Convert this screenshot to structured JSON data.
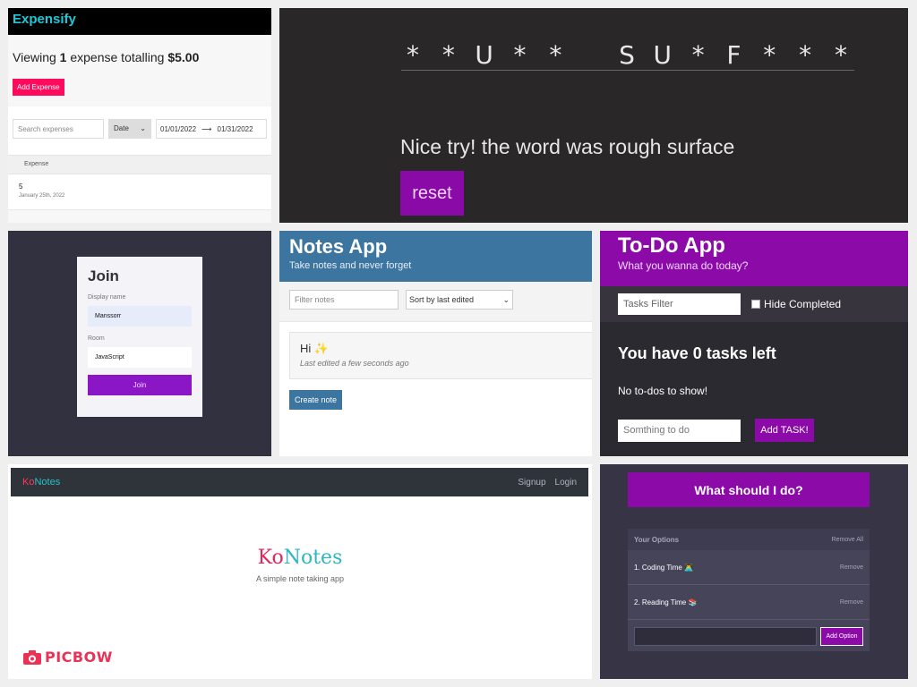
{
  "expensify": {
    "title": "Expensify",
    "summary_prefix": "Viewing",
    "summary_count": "1",
    "summary_mid": "expense totalling",
    "summary_total": "$5.00",
    "add_button": "Add Expense",
    "search_placeholder": "Search expenses",
    "sort_value": "Date",
    "start_date": "01/01/2022",
    "end_date": "01/31/2022",
    "table_header": "Expense",
    "rows": [
      {
        "amount": "5",
        "date": "January 25th, 2022"
      }
    ],
    "colors": {
      "brand": "#1fc8d8",
      "accent": "#ff0a5c"
    }
  },
  "hangman": {
    "letters": [
      "*",
      "*",
      "U",
      "*",
      "*",
      " ",
      "S",
      "U",
      "*",
      "F",
      "*",
      "*",
      "*"
    ],
    "message": "Nice try! the word was rough surface",
    "reset_button": "reset",
    "colors": {
      "button": "#8a0aa8"
    }
  },
  "join": {
    "title": "Join",
    "display_name_label": "Display name",
    "display_name_value": "Manssorr",
    "room_label": "Room",
    "room_value": "JavaScript",
    "join_button": "Join"
  },
  "notes_app": {
    "title": "Notes App",
    "subtitle": "Take notes and never forget",
    "filter_placeholder": "Filter notes",
    "sort_value": "Sort by last edited",
    "notes": [
      {
        "title": "Hi ✨",
        "edited": "Last edited a few seconds ago"
      }
    ],
    "create_button": "Create note",
    "colors": {
      "header": "#3c75a0"
    }
  },
  "todo": {
    "title": "To-Do App",
    "subtitle": "What you wanna do today?",
    "filter_placeholder": "Tasks Filter",
    "hide_completed_label": "Hide Completed",
    "hide_completed": false,
    "tasks_left": "You have 0 tasks left",
    "empty_message": "No to-dos to show!",
    "new_task_placeholder": "Somthing to do",
    "add_button": "Add TASK!",
    "colors": {
      "header": "#8b0aa8"
    }
  },
  "konotes": {
    "brand_ko": "Ko",
    "brand_notes": "Notes",
    "nav_links": [
      "Signup",
      "Login"
    ],
    "hero_ko": "Ko",
    "hero_notes": "Notes",
    "hero_sub": "A simple note taking app",
    "watermark": "PICBOW",
    "watermark_icon": "camera-icon"
  },
  "indecision": {
    "title": "What should I do?",
    "panel_title": "Your Options",
    "remove_all": "Remove All",
    "options": [
      {
        "text": "1. Coding Time 👨‍💻",
        "remove": "Remove"
      },
      {
        "text": "2. Reading Time 📚",
        "remove": "Remove"
      }
    ],
    "add_button": "Add Option"
  }
}
